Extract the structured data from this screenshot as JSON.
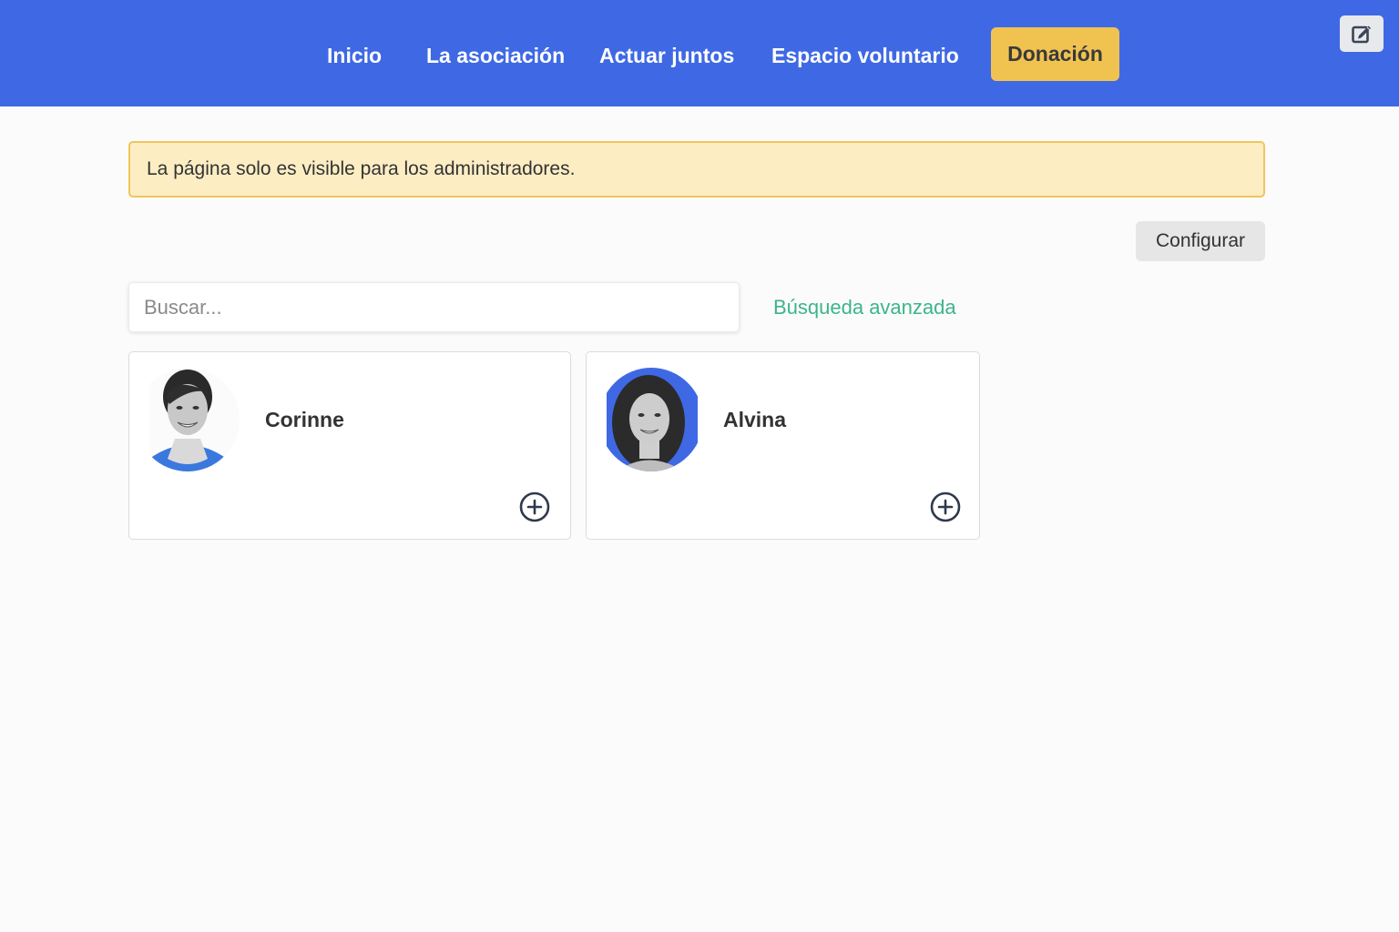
{
  "nav": {
    "items": [
      {
        "label": "Inicio"
      },
      {
        "label": "La asociación"
      },
      {
        "label": "Actuar juntos"
      },
      {
        "label": "Espacio voluntario"
      }
    ],
    "donate_label": "Donación"
  },
  "notice": {
    "text": "La página solo es visible para los administradores."
  },
  "configure_label": "Configurar",
  "search": {
    "placeholder": "Buscar...",
    "value": "",
    "advanced_label": "Búsqueda avanzada"
  },
  "members": [
    {
      "name": "Corinne"
    },
    {
      "name": "Alvina"
    }
  ],
  "colors": {
    "header": "#3f69e4",
    "donate": "#f0c351",
    "notice_bg": "#fcedc3",
    "notice_border": "#f2c55b",
    "link": "#3cb589"
  },
  "icons": {
    "edit": "edit-icon",
    "add": "plus-circle-icon"
  }
}
